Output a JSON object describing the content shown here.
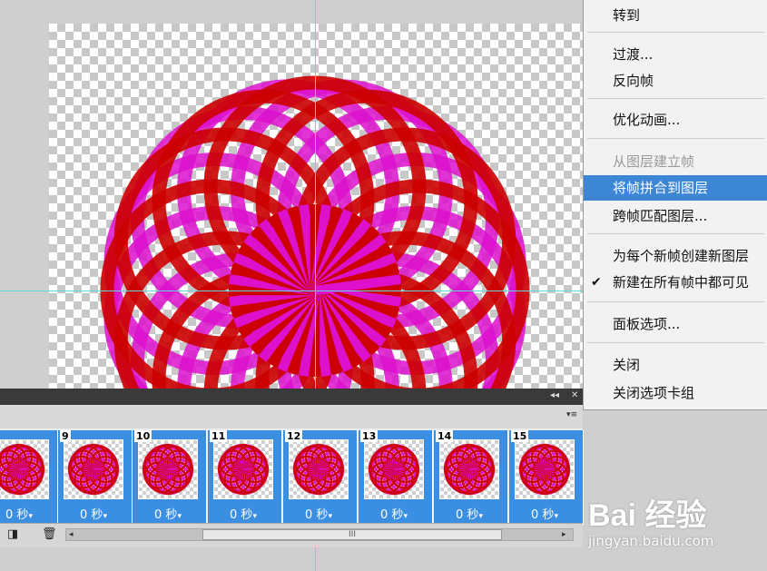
{
  "menu": {
    "items": [
      {
        "label": "转到",
        "state": "normal"
      },
      {
        "label": "过渡...",
        "state": "normal"
      },
      {
        "label": "反向帧",
        "state": "normal"
      },
      {
        "label": "优化动画...",
        "state": "normal"
      },
      {
        "label": "从图层建立帧",
        "state": "disabled"
      },
      {
        "label": "将帧拼合到图层",
        "state": "highlighted"
      },
      {
        "label": "跨帧匹配图层...",
        "state": "normal"
      },
      {
        "label": "为每个新帧创建新图层",
        "state": "normal"
      },
      {
        "label": "新建在所有帧中都可见",
        "state": "checked"
      },
      {
        "label": "面板选项...",
        "state": "normal"
      },
      {
        "label": "关闭",
        "state": "normal"
      },
      {
        "label": "关闭选项卡组",
        "state": "normal"
      }
    ],
    "check_mark": "✔"
  },
  "panel": {
    "collapse_glyph": "◂◂",
    "close_glyph": "✕",
    "menu_glyph": "▾≡",
    "frames": [
      {
        "number": "",
        "delay": "0 秒"
      },
      {
        "number": "9",
        "delay": "0 秒"
      },
      {
        "number": "10",
        "delay": "0 秒"
      },
      {
        "number": "11",
        "delay": "0 秒"
      },
      {
        "number": "12",
        "delay": "0 秒"
      },
      {
        "number": "13",
        "delay": "0 秒"
      },
      {
        "number": "14",
        "delay": "0 秒"
      },
      {
        "number": "15",
        "delay": "0 秒"
      }
    ],
    "delay_arrow": "▾",
    "scroll_grip": "III",
    "scroll_left": "◂",
    "scroll_right": "▸"
  },
  "watermark": {
    "logo": "Bai 经验",
    "url": "jingyan.baidu.com"
  },
  "colors": {
    "red_ring": "#cc0000",
    "magenta_ring": "#dd11cc",
    "menu_highlight": "#3d86d6",
    "frame_bg": "#3a8fe2"
  },
  "icons": {
    "new_frame": "new-frame-icon",
    "trash": "trash-icon"
  }
}
